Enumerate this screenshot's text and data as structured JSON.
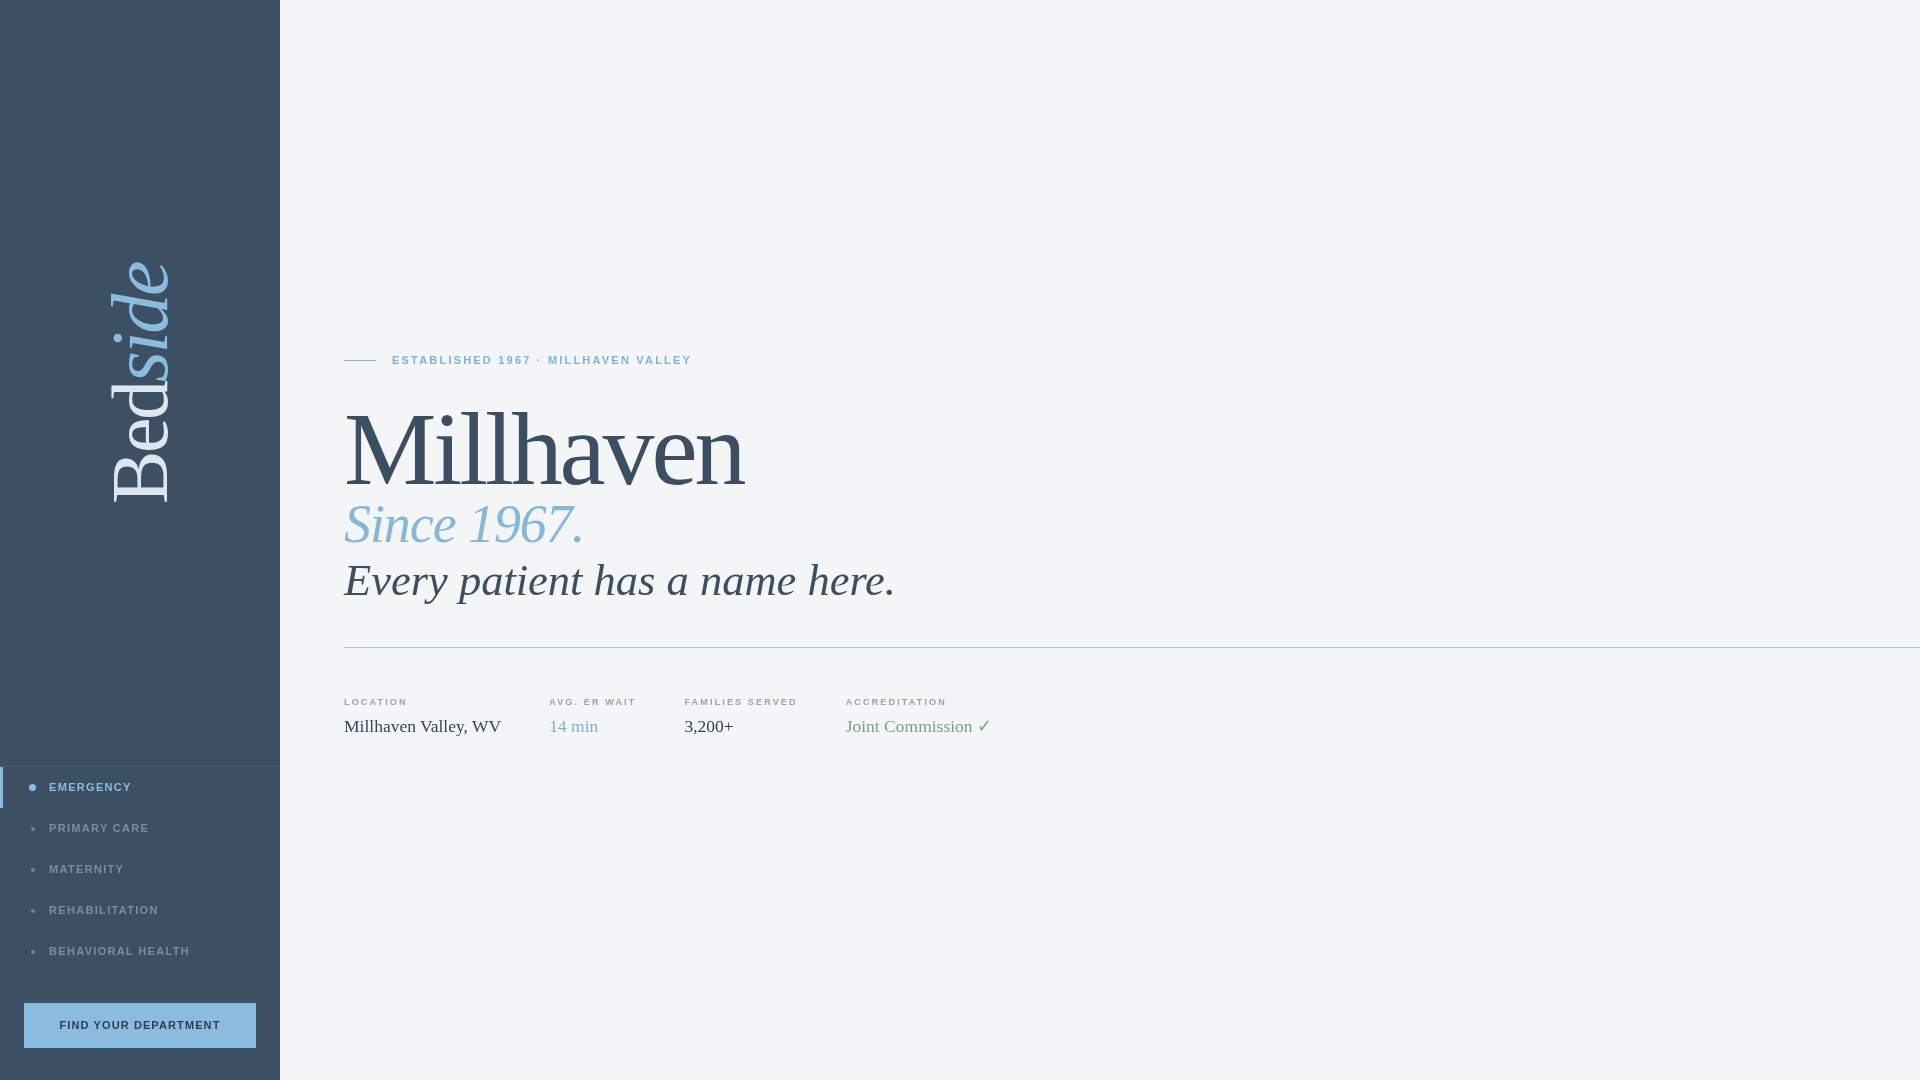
{
  "sidebar": {
    "logo": [
      {
        "text": "Bed",
        "italic": false
      },
      {
        "text": "side",
        "italic": true
      }
    ],
    "nav": [
      {
        "label": "EMERGENCY",
        "selected": true
      },
      {
        "label": "PRIMARY CARE",
        "selected": false
      },
      {
        "label": "MATERNITY",
        "selected": false
      },
      {
        "label": "REHABILITATION",
        "selected": false
      },
      {
        "label": "BEHAVIORAL HEALTH",
        "selected": false
      }
    ],
    "button": "FIND YOUR DEPARTMENT"
  },
  "hero": {
    "eyebrow": "ESTABLISHED 1967 · MILLHAVEN VALLEY",
    "title": "Millhaven",
    "subtitle": "Since 1967.",
    "tagline": "Every patient has a name here."
  },
  "stats": [
    {
      "label": "LOCATION",
      "value": "Millhaven Valley, WV",
      "color": "#34465a"
    },
    {
      "label": "AVG. ER WAIT",
      "value": "14 min",
      "color": "#7fb0d4"
    },
    {
      "label": "FAMILIES SERVED",
      "value": "3,200+",
      "color": "#2f3e50"
    },
    {
      "label": "ACCREDITATION",
      "value": "Joint Commission ✓",
      "color": "#79a383"
    }
  ]
}
